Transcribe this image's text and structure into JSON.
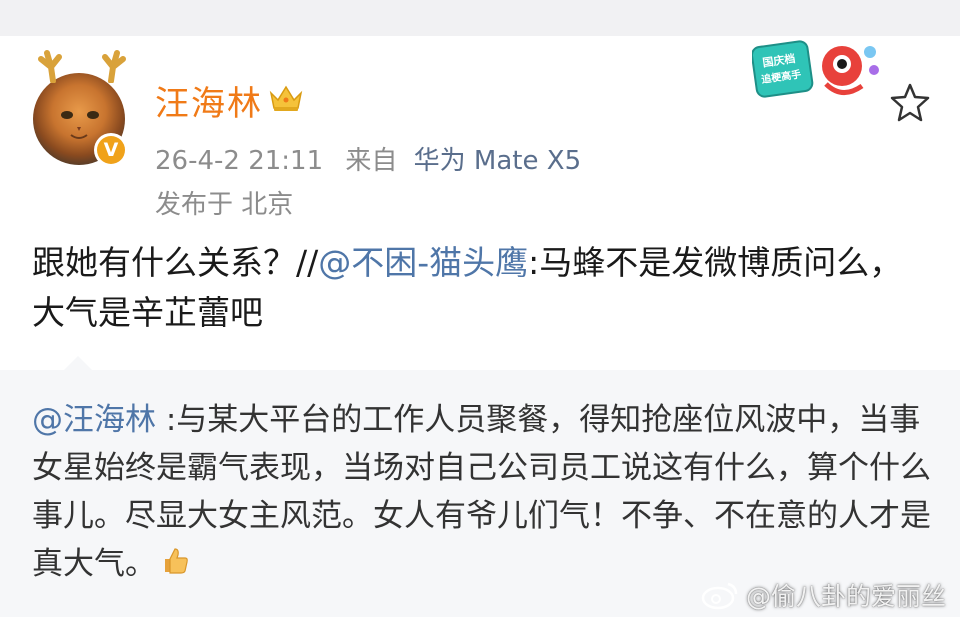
{
  "user": {
    "name": "汪海林",
    "verified": true,
    "verify_mark": "V",
    "icons": {
      "crown": "crown-icon",
      "verify": "verified-badge-icon"
    }
  },
  "meta": {
    "time": "26-4-2 21:11",
    "source_prefix": "来自",
    "device": "华为 Mate X5",
    "location": "发布于 北京"
  },
  "sticker": {
    "line1": "国庆档",
    "line2": "追梗高手"
  },
  "post": {
    "text_before": "跟她有什么关系？//",
    "mention": "@不困-猫头鹰",
    "text_after": ":马蜂不是发微博质问么，大气是辛芷蕾吧"
  },
  "quote": {
    "mention": "@汪海林",
    "text": " :与某大平台的工作人员聚餐，得知抢座位风波中，当事女星始终是霸气表现，当场对自己公司员工说这有什么，算个什么事儿。尽显大女主风范。女人有爷儿们气！不争、不在意的人才是真大气。",
    "emoji": "thumbs-up-icon"
  },
  "watermark": {
    "text": "@偷八卦的爱丽丝",
    "icon": "weibo-logo-icon"
  },
  "colors": {
    "username": "#f07a17",
    "mention": "#4f76a8",
    "meta": "#8c8c8c",
    "quote_bg": "#f6f7f9"
  }
}
